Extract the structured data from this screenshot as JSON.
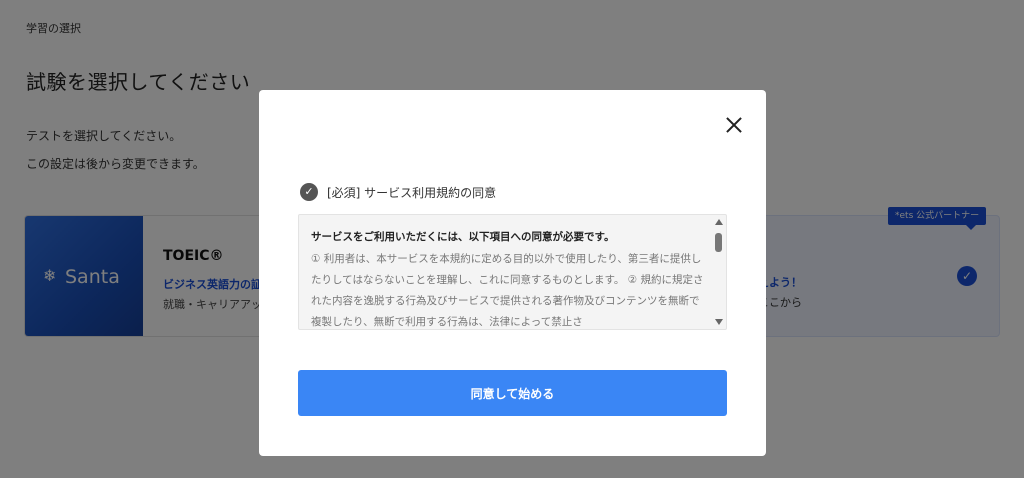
{
  "page": {
    "breadcrumb": "学習の選択",
    "title": "試験を選択してください",
    "description_line1": "テストを選択してください。",
    "description_line2": "この設定は後から変更できます。"
  },
  "cards": {
    "left": {
      "brand": "Santa",
      "title": "TOEIC®",
      "subtitle": "ビジネス英語力の証",
      "detail": "就職・キャリアアッ"
    },
    "right": {
      "subtitle": "えよう！",
      "detail": "ここから",
      "partner_badge": "*ets 公式パートナー",
      "selected": true
    }
  },
  "modal": {
    "agree_label": "[必須] サービス利用規約の同意",
    "terms_heading": "サービスをご利用いただくには、以下項目への同意が必要です。",
    "terms_body": "① 利用者は、本サービスを本規約に定める目的以外で使用したり、第三者に提供したりしてはならないことを理解し、これに同意するものとします。 ② 規約に規定された内容を逸脱する行為及びサービスで提供される著作物及びコンテンツを無断で複製したり、無断で利用する行為は、法律によって禁止さ",
    "start_button": "同意して始める"
  },
  "icons": {
    "close": "close-icon",
    "agree_check": "check-circle-icon",
    "selected_check": "check-circle-icon",
    "brand_logo": "snowflake-icon"
  },
  "colors": {
    "accent": "#3a86f5",
    "brand_blue": "#1a4fd6",
    "overlay": "rgba(0,0,0,0.5)"
  }
}
